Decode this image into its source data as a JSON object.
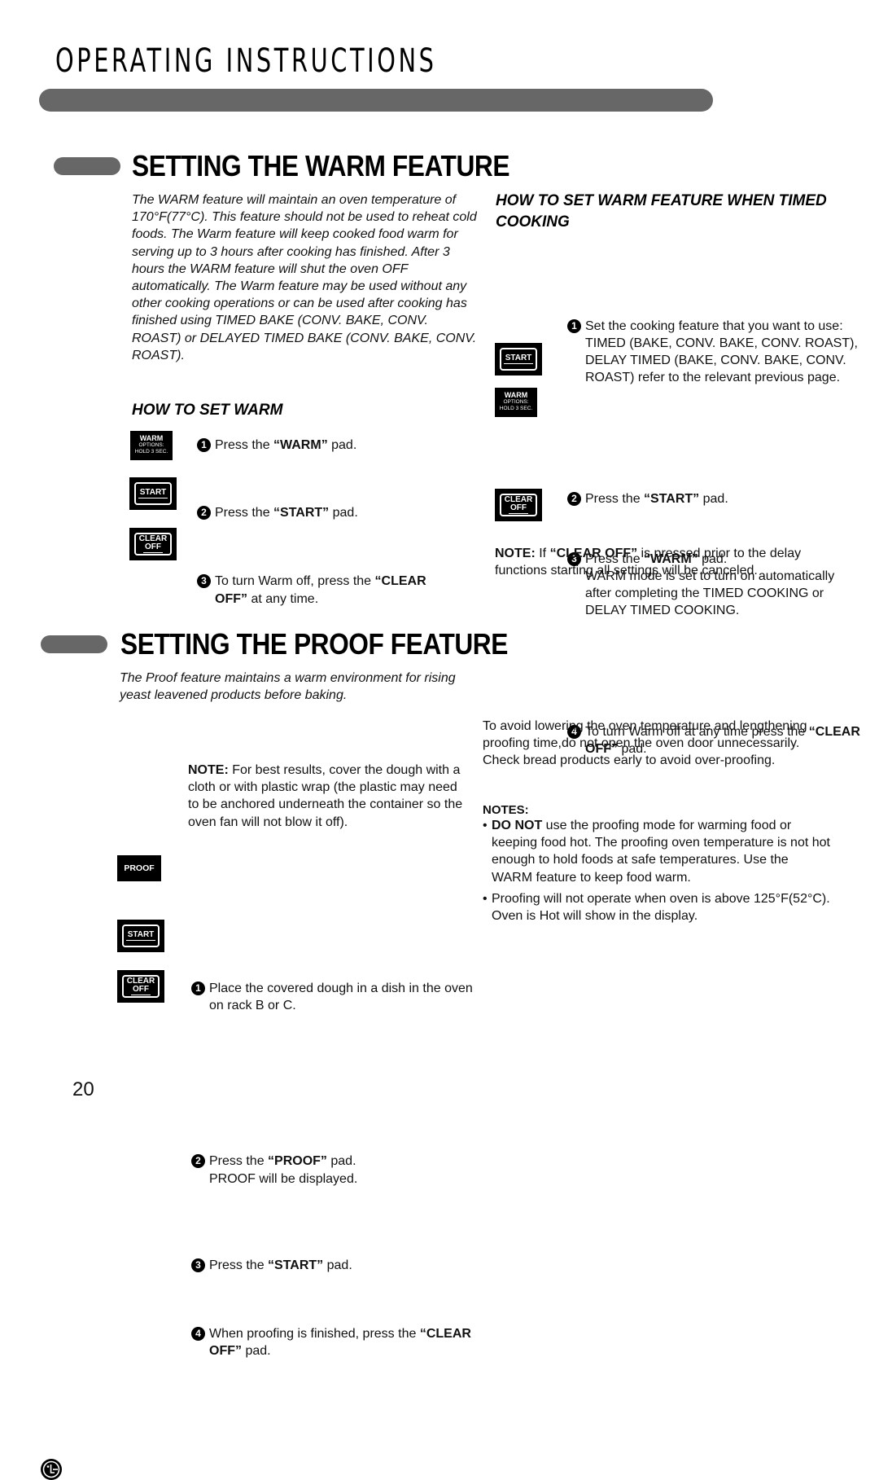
{
  "header": {
    "title": "OPERATING INSTRUCTIONS"
  },
  "warm": {
    "title": "SETTING THE WARM FEATURE",
    "intro": "The WARM feature will maintain an oven temperature of 170°F(77°C). This feature should not be used to reheat cold foods. The Warm feature will keep cooked food warm for serving up to 3 hours after cooking has finished. After 3 hours the WARM feature will shut the oven OFF automatically. The Warm feature may be used without any other cooking operations or can be used after cooking has finished using TIMED BAKE (CONV. BAKE, CONV. ROAST) or DELAYED TIMED BAKE (CONV. BAKE, CONV. ROAST).",
    "how_to": {
      "heading": "HOW TO SET WARM",
      "steps": [
        {
          "num": "1",
          "pre": "Press the ",
          "bold": "“WARM”",
          "post": " pad.",
          "pad": "warm"
        },
        {
          "num": "2",
          "pre": "Press the ",
          "bold": "“START”",
          "post": " pad.",
          "pad": "start"
        },
        {
          "num": "3",
          "pre": "To turn Warm off, press the ",
          "bold": "“CLEAR OFF”",
          "post": " at any time.",
          "pad": "clear-off"
        }
      ]
    },
    "timed": {
      "heading": "HOW TO SET WARM FEATURE WHEN TIMED COOKING",
      "steps": [
        {
          "num": "1",
          "text": "Set the cooking feature that you want to use: TIMED (BAKE, CONV. BAKE, CONV. ROAST), DELAY TIMED (BAKE, CONV. BAKE, CONV. ROAST) refer to the relevant previous page."
        },
        {
          "num": "2",
          "pre": "Press the ",
          "bold": "“START”",
          "post": " pad.",
          "pad": "start"
        },
        {
          "num": "3",
          "pre": "Press the ",
          "bold": "“WARM”",
          "post": " pad.",
          "extra": "WARM mode is set to turn on automatically after completing the TIMED COOKING or DELAY TIMED COOKING.",
          "pad": "warm"
        },
        {
          "num": "4",
          "pre": "To turn Warm off at any time press the ",
          "bold": "“CLEAR OFF”",
          "post": " pad.",
          "pad": "clear-off"
        }
      ],
      "note": {
        "label": "NOTE:",
        "pre": " If ",
        "bold": "“CLEAR OFF”",
        "post": " is pressed prior to the delay functions starting all settings will be canceled."
      }
    }
  },
  "proof": {
    "title": "SETTING THE PROOF FEATURE",
    "intro": "The Proof feature maintains a warm environment for rising yeast leavened products before baking.",
    "steps": [
      {
        "num": "1",
        "text": "Place the covered dough in a dish in the oven on rack B or C."
      },
      {
        "num": "2",
        "pre": "Press the ",
        "bold": "“PROOF”",
        "post": " pad.",
        "extra": "PROOF will be displayed.",
        "pad": "proof"
      },
      {
        "num": "3",
        "pre": "Press the ",
        "bold": "“START”",
        "post": " pad.",
        "pad": "start"
      },
      {
        "num": "4",
        "pre": "When proofing is finished, press the ",
        "bold": "“CLEAR OFF”",
        "post": " pad.",
        "pad": "clear-off"
      }
    ],
    "note": {
      "label": "NOTE:",
      "text": " For best results, cover the dough with a cloth or with plastic wrap (the plastic may need to be anchored underneath the container so the oven fan will not blow it off)."
    },
    "side_text": "To avoid lowering the oven temperature and lengthening proofing time,do not open the oven door unnecessarily. Check bread products early to avoid over-proofing.",
    "notes_heading": "NOTES:",
    "notes": [
      {
        "bold": "DO NOT",
        "text": " use the proofing mode for warming food or keeping food hot. The proofing oven temperature is not hot enough to hold foods at safe temperatures. Use the WARM feature to keep food warm."
      },
      {
        "bold": "",
        "text": "Proofing will not operate when oven is above 125°F(52°C). Oven is Hot will show in the display."
      }
    ]
  },
  "pads": {
    "warm": {
      "label": "WARM",
      "sub1": "OPTIONS:",
      "sub2": "HOLD 3 SEC."
    },
    "start": {
      "label": "START"
    },
    "clear_off": {
      "line1": "CLEAR",
      "line2": "OFF"
    },
    "proof": {
      "label": "PROOF"
    }
  },
  "footer": {
    "logo": "lg-logo",
    "page_number": "20"
  }
}
